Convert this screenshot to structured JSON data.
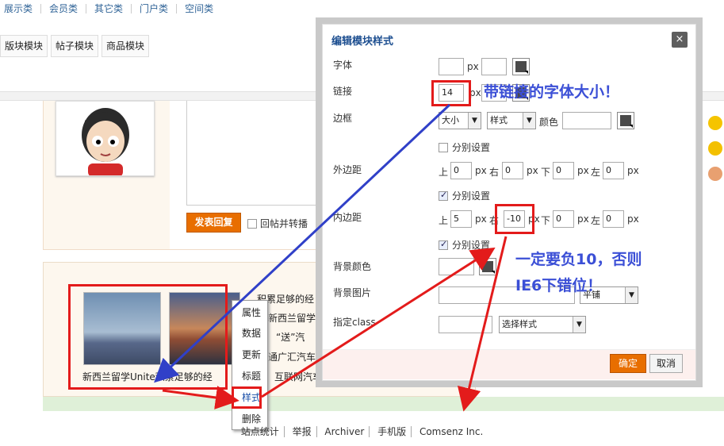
{
  "top_nav": [
    "展示类",
    "会员类",
    "其它类",
    "门户类",
    "空间类"
  ],
  "module_tabs": [
    "版块模块",
    "帖子模块",
    "商品模块"
  ],
  "post": {
    "reply_button": "发表回复",
    "forward_label": "回帖并转播"
  },
  "list_items": {
    "caption": "新西兰留学Unite积累足够的经",
    "lines": [
      "积累足够的经",
      "新西兰留学Un",
      "“送”汽",
      "通广汇汽车",
      "互联网汽车"
    ]
  },
  "context_menu": [
    "属性",
    "数据",
    "更新",
    "标题",
    "样式",
    "删除"
  ],
  "footer": {
    "links": [
      "站点统计",
      "举报",
      "Archiver",
      "手机版",
      "Comsenz Inc."
    ]
  },
  "modal": {
    "title": "编辑模块样式",
    "close": "×",
    "labels": {
      "font": "字体",
      "link": "链接",
      "border": "边框",
      "margin": "外边距",
      "padding": "内边距",
      "bg_color": "背景颜色",
      "bg_image": "背景图片",
      "class": "指定class"
    },
    "unit": "px",
    "font_size": "",
    "link_size": "14",
    "border_size": "大小",
    "border_style": "样式",
    "color_label": "颜色",
    "separate": "分别设置",
    "dirs": {
      "top": "上",
      "right": "右",
      "bottom": "下",
      "left": "左"
    },
    "margin_values": [
      "0",
      "0",
      "0",
      "0"
    ],
    "padding_values": [
      "5",
      "-10",
      "0",
      "0"
    ],
    "bg_repeat": "平铺",
    "class_select": "选择样式",
    "ok": "确定",
    "cancel": "取消"
  },
  "annotations": {
    "top": "带链接的字体大小！",
    "mid_line1": "一定要负10，否则",
    "mid_line2": "IE6下错位！"
  },
  "colors": {
    "annotation": "#3b4fd6",
    "arrow_red": "#e31b1b",
    "arrow_blue": "#3040c8",
    "accent": "#e86e00"
  }
}
